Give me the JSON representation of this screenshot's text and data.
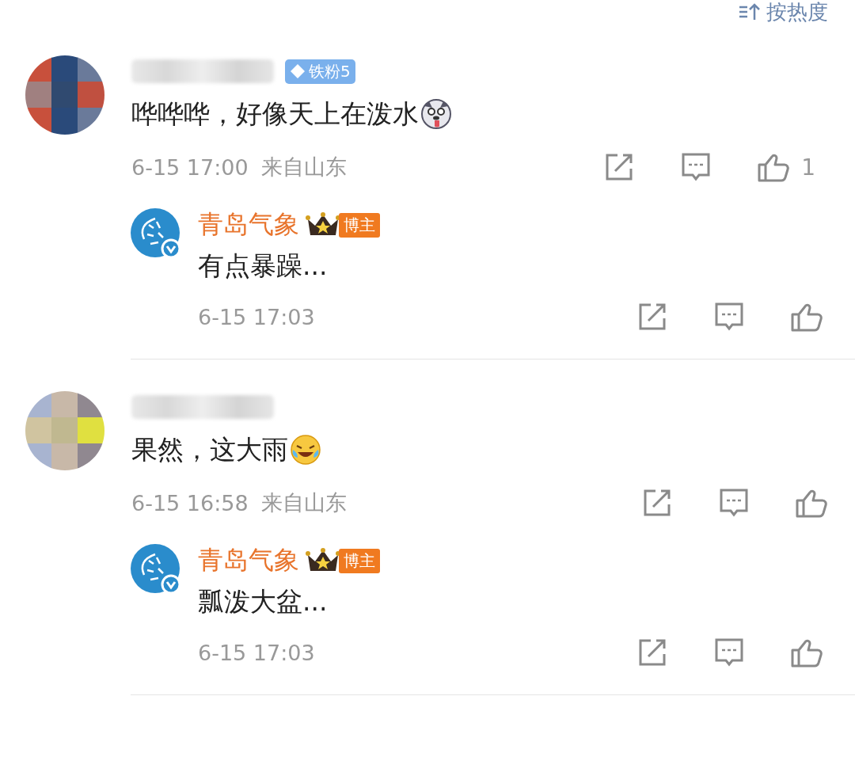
{
  "sort": {
    "label": "按热度"
  },
  "comments": [
    {
      "fan_badge": "铁粉5",
      "text": "哗哗哗，好像天上在泼水",
      "time": "6-15 17:00",
      "location": "来自山东",
      "likes": "1",
      "replies": [
        {
          "name": "青岛气象",
          "badge": "博主",
          "text": "有点暴躁...",
          "time": "6-15 17:03"
        }
      ]
    },
    {
      "text": "果然，这大雨",
      "time": "6-15 16:58",
      "location": "来自山东",
      "replies": [
        {
          "name": "青岛气象",
          "badge": "博主",
          "text": "瓢泼大盆...",
          "time": "6-15 17:03"
        }
      ]
    }
  ]
}
